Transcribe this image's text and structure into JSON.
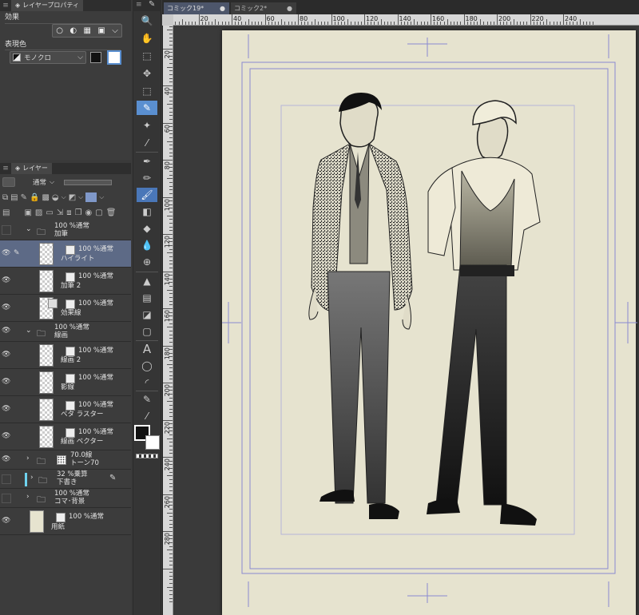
{
  "props_panel": {
    "tab": "レイヤープロパティ",
    "effect_label": "効果",
    "display_color_label": "表現色",
    "display_color_value": "モノクロ"
  },
  "layer_panel": {
    "tab": "レイヤー",
    "blend_mode": "通常",
    "layers": [
      {
        "meta": "100 %通常",
        "name": "加筆",
        "kind": "folder"
      },
      {
        "meta": "100 %通常",
        "name": "ハイライト",
        "kind": "layer",
        "selected": true
      },
      {
        "meta": "100 %通常",
        "name": "加筆 2",
        "kind": "layer"
      },
      {
        "meta": "100 %通常",
        "name": "効果線",
        "kind": "layer"
      },
      {
        "meta": "100 %通常",
        "name": "線画",
        "kind": "folder"
      },
      {
        "meta": "100 %通常",
        "name": "線画 2",
        "kind": "layer"
      },
      {
        "meta": "100 %通常",
        "name": "影線",
        "kind": "layer"
      },
      {
        "meta": "100 %通常",
        "name": "ベタ  ラスター",
        "kind": "layer"
      },
      {
        "meta": "100 %通常",
        "name": "線画  ベクター",
        "kind": "layer"
      },
      {
        "meta": "70.0線",
        "name": "トーン70",
        "kind": "folder"
      },
      {
        "meta": "32 %乗算",
        "name": "下書き",
        "kind": "folder"
      },
      {
        "meta": "100 %通常",
        "name": "コマ･背景",
        "kind": "folder"
      },
      {
        "meta": "100 %通常",
        "name": "用紙",
        "kind": "paper"
      }
    ]
  },
  "tabs": [
    {
      "label": "コミック19*",
      "active": true
    },
    {
      "label": "コミック2*",
      "active": false
    }
  ],
  "ruler_top": [
    "20",
    "40",
    "60",
    "80",
    "100",
    "120",
    "140",
    "160",
    "180",
    "200",
    "220",
    "240"
  ],
  "ruler_left": [
    "20",
    "40",
    "60",
    "80",
    "100",
    "120",
    "140",
    "160",
    "180",
    "200",
    "220",
    "240",
    "260",
    "280"
  ],
  "colors": {
    "paper": "#e6e3cf",
    "accent": "#5d6a86",
    "tool_active": "#5a8fd0",
    "guide": "#8a8ad0"
  }
}
